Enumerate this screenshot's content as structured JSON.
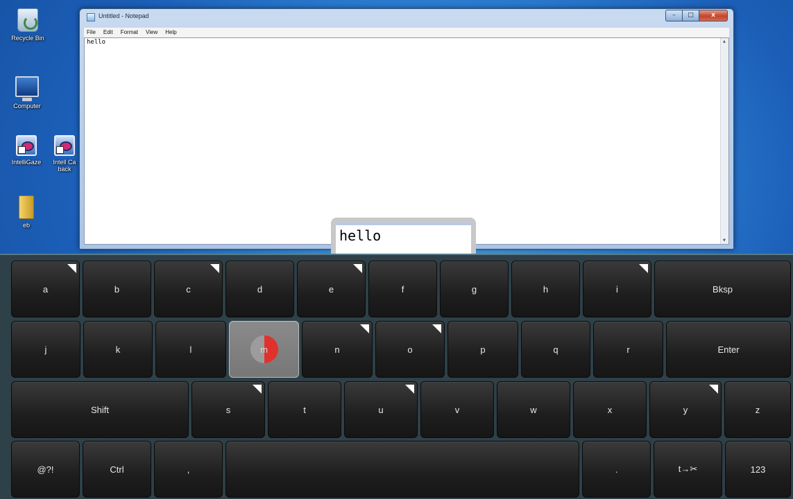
{
  "desktop": {
    "icons": [
      {
        "label": "Recycle Bin"
      },
      {
        "label": "Computer"
      },
      {
        "label": "IntelliGaze"
      },
      {
        "label": "Intell Ca back"
      },
      {
        "label": "eb"
      }
    ]
  },
  "notepad": {
    "title": "Untitled - Notepad",
    "menu": [
      "File",
      "Edit",
      "Format",
      "View",
      "Help"
    ],
    "content": "hello",
    "controls": {
      "minimize": "–",
      "maximize": "□",
      "close": "x"
    }
  },
  "suggestion": {
    "text": "hello"
  },
  "keyboard": {
    "dwell_key": "m",
    "dwell_progress": 0.5,
    "rows": [
      [
        "a",
        "b",
        "c",
        "d",
        "e",
        "f",
        "g",
        "h",
        "i",
        "Bksp"
      ],
      [
        "j",
        "k",
        "l",
        "m",
        "n",
        "o",
        "p",
        "q",
        "r",
        "Enter"
      ],
      [
        "Shift",
        "s",
        "t",
        "u",
        "v",
        "w",
        "x",
        "y",
        "z"
      ],
      [
        "@?!",
        "Ctrl",
        ",",
        "",
        ".",
        "t→✂",
        "123"
      ]
    ]
  }
}
